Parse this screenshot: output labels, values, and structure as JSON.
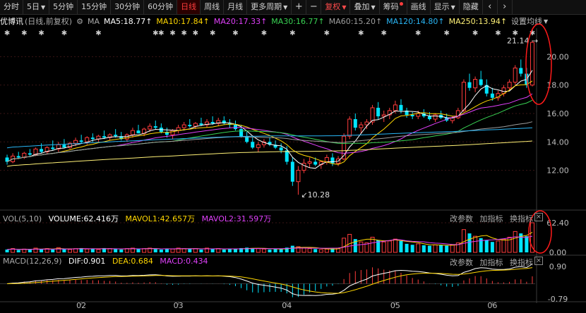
{
  "toolbar": {
    "items": [
      {
        "label": "分时",
        "active": false
      },
      {
        "label": "5日",
        "active": false,
        "caret": true
      },
      {
        "label": "5分钟",
        "active": false
      },
      {
        "label": "15分钟",
        "active": false
      },
      {
        "label": "30分钟",
        "active": false
      },
      {
        "label": "60分钟",
        "active": false
      },
      {
        "label": "日线",
        "active": true
      },
      {
        "label": "周线",
        "active": false
      },
      {
        "label": "月线",
        "active": false
      },
      {
        "label": "更多周期",
        "active": false,
        "caret": true
      }
    ],
    "zoom_in": "+",
    "zoom_out": "−",
    "fuquan_label": "复权",
    "diejia_label": "叠加",
    "chouma_label": "筹码",
    "huaxian_label": "画线",
    "xianshi_label": "显示",
    "yincang_label": "隐藏",
    "nav_prev": "‹",
    "nav_next": "›"
  },
  "infobar": {
    "stock_name": "优博讯",
    "stock_mode": "(日线,前复权)",
    "ma_label": "MA",
    "ma_values": [
      {
        "text": "MA5:18.77",
        "color": "#ffffff"
      },
      {
        "text": "MA10:17.84",
        "color": "#ffd700"
      },
      {
        "text": "MA20:17.33",
        "color": "#e040fb"
      },
      {
        "text": "MA30:16.77",
        "color": "#39d353"
      },
      {
        "text": "MA60:15.20",
        "color": "#9e9e9e"
      },
      {
        "text": "MA120:14.80",
        "color": "#29b6f6"
      },
      {
        "text": "MA250:13.94",
        "color": "#fff176"
      }
    ],
    "settings_label": "设置均线"
  },
  "volume_panel": {
    "title": "VOL(5,10)",
    "volume": "VOLUME:62.416万",
    "mavol1": "MAVOL1:42.657万",
    "mavol2": "MAVOL2:31.597万",
    "modify_params": "改参数",
    "add_indicator": "加指标",
    "change_indicator": "换指标",
    "close_label": "×"
  },
  "macd_panel": {
    "title": "MACD(12,26,9)",
    "dif": "DIF:0.901",
    "dea": "DEA:0.684",
    "macd": "MACD:0.434",
    "modify_params": "改参数",
    "add_indicator": "加指标",
    "change_indicator": "换指标",
    "close_label": "×"
  },
  "price_axis": {
    "ticks": [
      "20.00",
      "18.00",
      "16.00",
      "14.00",
      "12.00"
    ],
    "high_annotation": "21.14",
    "low_annotation": "10.28"
  },
  "volume_axis": {
    "ticks": [
      "62.40",
      "0.00"
    ]
  },
  "macd_axis": {
    "ticks": [
      "0.90",
      "-0.79"
    ]
  },
  "date_axis": {
    "ticks": [
      "02",
      "03",
      "04",
      "05",
      "06"
    ]
  },
  "colors": {
    "up": "#ff3c3c",
    "down": "#00e5ff",
    "highlight_circle": "#ff1a1a"
  },
  "chart_data": {
    "type": "candlestick",
    "y_range": [
      10.28,
      21.14
    ],
    "candles": [
      [
        12.9,
        13.1,
        12.4,
        12.6
      ],
      [
        12.6,
        13.2,
        12.5,
        13.0
      ],
      [
        13.0,
        13.3,
        12.8,
        12.9
      ],
      [
        12.9,
        13.3,
        12.8,
        13.2
      ],
      [
        13.2,
        13.5,
        13.0,
        13.1
      ],
      [
        13.1,
        13.6,
        13.0,
        13.5
      ],
      [
        13.5,
        13.9,
        13.2,
        13.3
      ],
      [
        13.3,
        13.7,
        13.1,
        13.6
      ],
      [
        13.6,
        14.1,
        13.4,
        13.5
      ],
      [
        13.5,
        14.0,
        13.3,
        13.8
      ],
      [
        13.8,
        14.2,
        13.6,
        13.6
      ],
      [
        13.6,
        14.0,
        13.5,
        13.9
      ],
      [
        13.9,
        14.3,
        13.7,
        14.1
      ],
      [
        14.1,
        14.5,
        13.9,
        14.0
      ],
      [
        14.0,
        14.4,
        13.8,
        14.3
      ],
      [
        14.3,
        14.6,
        14.0,
        14.2
      ],
      [
        14.2,
        14.5,
        14.0,
        14.4
      ],
      [
        14.4,
        14.8,
        14.2,
        14.3
      ],
      [
        14.3,
        14.6,
        14.1,
        14.5
      ],
      [
        14.5,
        14.9,
        14.3,
        14.4
      ],
      [
        14.4,
        14.7,
        14.1,
        14.2
      ],
      [
        14.2,
        14.6,
        14.0,
        14.5
      ],
      [
        14.5,
        15.0,
        14.3,
        14.8
      ],
      [
        14.8,
        15.2,
        14.6,
        14.6
      ],
      [
        14.6,
        15.0,
        14.4,
        14.9
      ],
      [
        14.9,
        15.3,
        14.7,
        15.1
      ],
      [
        15.1,
        15.5,
        14.9,
        15.0
      ],
      [
        15.0,
        15.3,
        14.6,
        14.7
      ],
      [
        14.7,
        15.0,
        14.3,
        14.5
      ],
      [
        14.5,
        14.9,
        14.2,
        14.8
      ],
      [
        14.8,
        15.2,
        14.6,
        15.0
      ],
      [
        15.0,
        15.4,
        14.8,
        15.2
      ],
      [
        15.2,
        15.6,
        15.0,
        15.1
      ],
      [
        15.1,
        15.4,
        14.9,
        15.3
      ],
      [
        15.3,
        15.7,
        15.1,
        15.2
      ],
      [
        15.2,
        15.6,
        15.0,
        15.4
      ],
      [
        15.4,
        15.8,
        15.2,
        15.3
      ],
      [
        15.3,
        15.7,
        15.1,
        15.5
      ],
      [
        15.5,
        15.8,
        15.2,
        15.3
      ],
      [
        15.3,
        15.6,
        15.0,
        15.2
      ],
      [
        15.2,
        15.5,
        14.8,
        14.9
      ],
      [
        14.9,
        15.2,
        14.3,
        14.4
      ],
      [
        14.4,
        14.7,
        13.9,
        14.0
      ],
      [
        14.0,
        14.3,
        13.5,
        13.6
      ],
      [
        13.6,
        14.0,
        13.3,
        13.8
      ],
      [
        13.8,
        14.2,
        13.6,
        14.0
      ],
      [
        14.0,
        14.3,
        13.7,
        13.8
      ],
      [
        13.8,
        14.1,
        13.5,
        13.6
      ],
      [
        13.6,
        13.9,
        13.2,
        13.4
      ],
      [
        13.4,
        13.7,
        12.4,
        12.6
      ],
      [
        12.6,
        12.9,
        10.9,
        11.2
      ],
      [
        11.2,
        12.3,
        10.28,
        12.0
      ],
      [
        12.0,
        12.8,
        11.8,
        12.5
      ],
      [
        12.5,
        12.9,
        12.2,
        12.6
      ],
      [
        12.6,
        12.9,
        12.3,
        12.4
      ],
      [
        12.4,
        12.7,
        12.1,
        12.6
      ],
      [
        12.6,
        13.1,
        12.4,
        12.9
      ],
      [
        12.9,
        13.2,
        12.3,
        12.5
      ],
      [
        12.5,
        13.0,
        12.3,
        12.8
      ],
      [
        12.8,
        14.6,
        12.7,
        14.4
      ],
      [
        14.4,
        15.8,
        14.2,
        15.6
      ],
      [
        15.6,
        16.0,
        14.8,
        15.0
      ],
      [
        15.0,
        15.4,
        14.6,
        15.2
      ],
      [
        15.2,
        15.6,
        14.9,
        15.4
      ],
      [
        15.4,
        16.6,
        15.2,
        16.4
      ],
      [
        16.4,
        16.8,
        15.6,
        15.8
      ],
      [
        15.8,
        16.2,
        15.4,
        15.9
      ],
      [
        15.9,
        16.4,
        15.6,
        16.2
      ],
      [
        16.2,
        16.9,
        16.0,
        16.6
      ],
      [
        16.6,
        17.0,
        16.0,
        16.2
      ],
      [
        16.2,
        16.4,
        15.7,
        15.9
      ],
      [
        15.9,
        16.1,
        15.6,
        15.8
      ],
      [
        15.8,
        16.2,
        15.6,
        16.0
      ],
      [
        16.0,
        16.3,
        15.7,
        15.8
      ],
      [
        15.8,
        16.1,
        15.5,
        15.6
      ],
      [
        15.6,
        16.0,
        15.4,
        15.9
      ],
      [
        15.9,
        16.2,
        15.6,
        15.7
      ],
      [
        15.7,
        16.0,
        15.4,
        15.5
      ],
      [
        15.5,
        15.8,
        15.3,
        15.7
      ],
      [
        15.7,
        16.4,
        15.6,
        16.2
      ],
      [
        16.2,
        18.4,
        16.1,
        18.2
      ],
      [
        18.2,
        18.8,
        17.6,
        17.8
      ],
      [
        17.8,
        18.6,
        17.5,
        18.4
      ],
      [
        18.4,
        19.0,
        17.9,
        18.0
      ],
      [
        18.0,
        18.4,
        17.2,
        17.4
      ],
      [
        17.4,
        17.8,
        16.9,
        17.1
      ],
      [
        17.1,
        17.6,
        16.9,
        17.4
      ],
      [
        17.4,
        18.0,
        17.2,
        17.8
      ],
      [
        17.8,
        18.4,
        17.6,
        18.2
      ],
      [
        18.2,
        19.4,
        18.0,
        19.2
      ],
      [
        19.2,
        19.8,
        18.6,
        18.8
      ],
      [
        18.8,
        19.2,
        17.8,
        18.0
      ],
      [
        18.0,
        21.14,
        17.9,
        21.0
      ]
    ],
    "volumes": [
      6,
      8,
      5,
      7,
      6,
      9,
      7,
      8,
      6,
      10,
      7,
      6,
      8,
      9,
      7,
      8,
      6,
      9,
      8,
      7,
      6,
      8,
      9,
      7,
      8,
      9,
      7,
      6,
      8,
      7,
      9,
      8,
      7,
      8,
      6,
      9,
      7,
      8,
      6,
      7,
      8,
      9,
      10,
      9,
      8,
      7,
      6,
      7,
      8,
      10,
      14,
      12,
      9,
      8,
      7,
      6,
      7,
      8,
      9,
      30,
      38,
      28,
      22,
      20,
      32,
      26,
      22,
      24,
      28,
      24,
      18,
      16,
      18,
      15,
      14,
      16,
      15,
      14,
      16,
      20,
      48,
      40,
      34,
      30,
      26,
      22,
      24,
      28,
      32,
      44,
      40,
      34,
      62.4
    ],
    "vol_axis": [
      0,
      62.4
    ],
    "macd_axis": [
      -0.79,
      0.9
    ],
    "macd_last": {
      "dif": 0.901,
      "dea": 0.684,
      "macd": 0.434
    },
    "dates": [
      "02",
      "03",
      "04",
      "05",
      "06"
    ]
  }
}
